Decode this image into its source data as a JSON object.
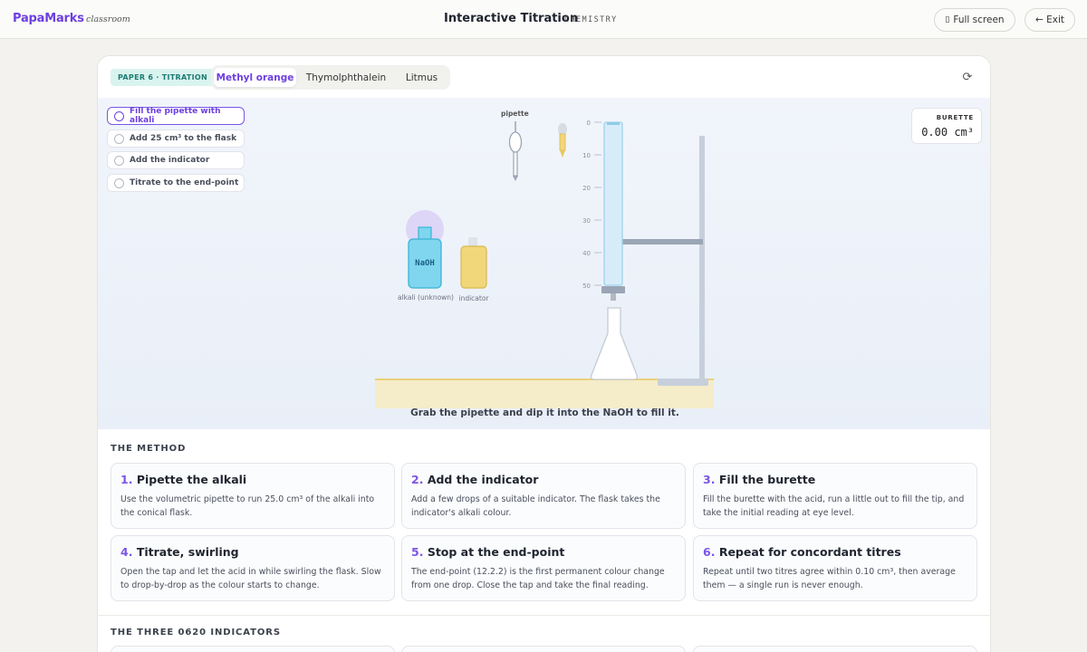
{
  "topbar": {
    "brand": "PapaMarks",
    "brand_sub": "classroom",
    "title": "Interactive Titration",
    "subtitle": "CHEMISTRY",
    "fullscreen_label": "Full screen",
    "exit_label": "← Exit"
  },
  "header": {
    "badge": "PAPER 6 · TITRATION",
    "tabs": [
      {
        "label": "Methyl orange",
        "active": true
      },
      {
        "label": "Thymolphthalein",
        "active": false
      },
      {
        "label": "Litmus",
        "active": false
      }
    ]
  },
  "steps": [
    {
      "label": "Fill the pipette with alkali",
      "active": true
    },
    {
      "label": "Add 25 cm³ to the flask",
      "active": false
    },
    {
      "label": "Add the indicator",
      "active": false
    },
    {
      "label": "Titrate to the end-point",
      "active": false
    }
  ],
  "burette": {
    "label": "BURETTE",
    "value": "0.00 cm³",
    "scale": [
      "0",
      "10",
      "20",
      "30",
      "40",
      "50"
    ]
  },
  "apparatus": {
    "pipette_label": "pipette",
    "alkali_bottle_text": "NaOH",
    "alkali_label": "alkali (unknown)",
    "indicator_label": "indicator"
  },
  "colors": {
    "accent": "#6d3fe0",
    "alkali": "#7fd6ee",
    "indicator": "#f2d77a",
    "bench": "#f5ecc9"
  },
  "hint": "Grab the pipette and dip it into the NaOH to fill it.",
  "method": {
    "title": "THE METHOD",
    "cards": [
      {
        "num": "1.",
        "title": "Pipette the alkali",
        "body": "Use the volumetric pipette to run 25.0 cm³ of the alkali into the conical flask."
      },
      {
        "num": "2.",
        "title": "Add the indicator",
        "body": "Add a few drops of a suitable indicator. The flask takes the indicator's alkali colour."
      },
      {
        "num": "3.",
        "title": "Fill the burette",
        "body": "Fill the burette with the acid, run a little out to fill the tip, and take the initial reading at eye level."
      },
      {
        "num": "4.",
        "title": "Titrate, swirling",
        "body": "Open the tap and let the acid in while swirling the flask. Slow to drop-by-drop as the colour starts to change."
      },
      {
        "num": "5.",
        "title": "Stop at the end-point",
        "body": "The end-point (12.2.2) is the first permanent colour change from one drop. Close the tap and take the final reading."
      },
      {
        "num": "6.",
        "title": "Repeat for concordant titres",
        "body": "Repeat until two titres agree within 0.10 cm³, then average them — a single run is never enough."
      }
    ]
  },
  "indicators": {
    "title": "THE THREE 0620 INDICATORS"
  }
}
